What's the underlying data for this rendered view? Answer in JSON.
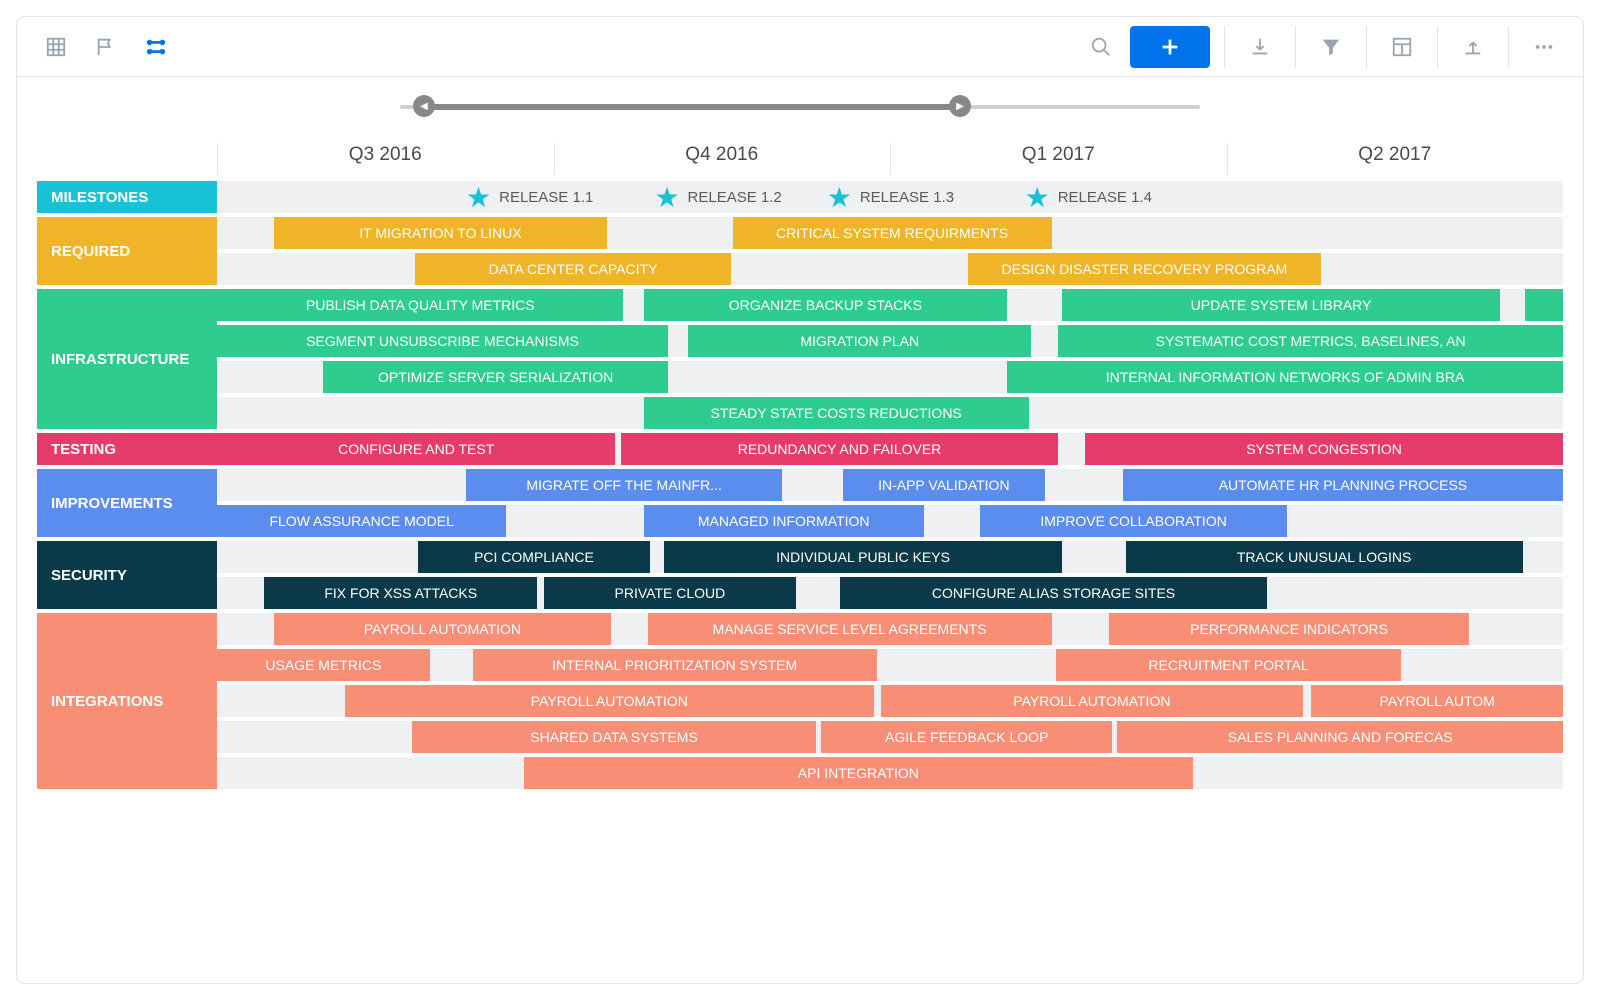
{
  "chart_data": {
    "type": "bar",
    "orientation": "gantt",
    "x_axis": {
      "type": "time",
      "start_quarter": "Q3 2016",
      "end_quarter": "Q2 2017",
      "columns": [
        "Q3 2016",
        "Q4 2016",
        "Q1 2017",
        "Q2 2017"
      ]
    },
    "lanes": [
      {
        "name": "MILESTONES",
        "color": "#17c2d7",
        "type": "milestones",
        "rows": [
          {
            "items": [
              {
                "label": "RELEASE 1.1",
                "position": 18.5
              },
              {
                "label": "RELEASE 1.2",
                "position": 32.5
              },
              {
                "label": "RELEASE 1.3",
                "position": 45.3
              },
              {
                "label": "RELEASE 1.4",
                "position": 60.0
              }
            ]
          }
        ]
      },
      {
        "name": "REQUIRED",
        "color": "#f0b429",
        "rows": [
          {
            "bars": [
              {
                "label": "IT MIGRATION TO LINUX",
                "start": 4.2,
                "end": 29.0
              },
              {
                "label": "CRITICAL SYSTEM REQUIRMENTS",
                "start": 38.3,
                "end": 62.0
              }
            ]
          },
          {
            "bars": [
              {
                "label": "DATA CENTER CAPACITY",
                "start": 14.7,
                "end": 38.2
              },
              {
                "label": "DESIGN DISASTER RECOVERY PROGRAM",
                "start": 55.8,
                "end": 82.0
              }
            ]
          }
        ]
      },
      {
        "name": "INFRASTRUCTURE",
        "color": "#2ecc8f",
        "rows": [
          {
            "bars": [
              {
                "label": "PUBLISH DATA QUALITY METRICS",
                "start": 0.0,
                "end": 30.2
              },
              {
                "label": "ORGANIZE BACKUP STACKS",
                "start": 31.7,
                "end": 58.7
              },
              {
                "label": "UPDATE SYSTEM LIBRARY",
                "start": 62.8,
                "end": 95.3
              },
              {
                "label": "",
                "start": 97.2,
                "end": 100.0
              }
            ]
          },
          {
            "bars": [
              {
                "label": "SEGMENT UNSUBSCRIBE MECHANISMS",
                "start": 0.0,
                "end": 33.5
              },
              {
                "label": "MIGRATION PLAN",
                "start": 35.0,
                "end": 60.5
              },
              {
                "label": "SYSTEMATIC COST METRICS, BASELINES, AN",
                "start": 62.5,
                "end": 100.0
              }
            ]
          },
          {
            "bars": [
              {
                "label": "OPTIMIZE SERVER SERIALIZATION",
                "start": 7.9,
                "end": 33.5
              },
              {
                "label": "INTERNAL INFORMATION NETWORKS OF ADMIN BRA",
                "start": 58.7,
                "end": 100.0
              }
            ]
          },
          {
            "bars": [
              {
                "label": "STEADY STATE COSTS REDUCTIONS",
                "start": 31.7,
                "end": 60.3
              }
            ]
          }
        ]
      },
      {
        "name": "TESTING",
        "color": "#e73c6b",
        "rows": [
          {
            "bars": [
              {
                "label": "CONFIGURE AND TEST",
                "start": 0.0,
                "end": 29.6
              },
              {
                "label": "REDUNDANCY AND FAILOVER",
                "start": 30.0,
                "end": 62.5
              },
              {
                "label": "SYSTEM CONGESTION",
                "start": 64.5,
                "end": 100.0
              }
            ]
          }
        ]
      },
      {
        "name": "IMPROVEMENTS",
        "color": "#5b8def",
        "rows": [
          {
            "bars": [
              {
                "label": "MIGRATE OFF THE MAINFR...",
                "start": 18.5,
                "end": 42.0
              },
              {
                "label": "IN-APP VALIDATION",
                "start": 46.5,
                "end": 61.5
              },
              {
                "label": "AUTOMATE HR PLANNING PROCESS",
                "start": 67.3,
                "end": 100.0
              }
            ]
          },
          {
            "bars": [
              {
                "label": "FLOW ASSURANCE MODEL",
                "start": 0.0,
                "end": 21.5
              },
              {
                "label": "MANAGED INFORMATION",
                "start": 31.7,
                "end": 52.5
              },
              {
                "label": "IMPROVE COLLABORATION",
                "start": 56.7,
                "end": 79.5
              }
            ]
          }
        ]
      },
      {
        "name": "SECURITY",
        "color": "#0a3a4a",
        "rows": [
          {
            "bars": [
              {
                "label": "PCI COMPLIANCE",
                "start": 14.9,
                "end": 32.2
              },
              {
                "label": "INDIVIDUAL PUBLIC KEYS",
                "start": 33.2,
                "end": 62.8
              },
              {
                "label": "TRACK UNUSUAL LOGINS",
                "start": 67.5,
                "end": 97.0
              }
            ]
          },
          {
            "bars": [
              {
                "label": "FIX FOR XSS ATTACKS",
                "start": 3.5,
                "end": 23.8
              },
              {
                "label": "PRIVATE CLOUD",
                "start": 24.3,
                "end": 43.0
              },
              {
                "label": "CONFIGURE ALIAS STORAGE SITES",
                "start": 46.3,
                "end": 78.0
              }
            ]
          }
        ]
      },
      {
        "name": "INTEGRATIONS",
        "color": "#f88e76",
        "rows": [
          {
            "bars": [
              {
                "label": "PAYROLL AUTOMATION",
                "start": 4.2,
                "end": 29.3
              },
              {
                "label": "MANAGE SERVICE LEVEL AGREEMENTS",
                "start": 32.0,
                "end": 62.0
              },
              {
                "label": "PERFORMANCE INDICATORS",
                "start": 66.3,
                "end": 93.0
              }
            ]
          },
          {
            "bars": [
              {
                "label": "USAGE METRICS",
                "start": 0.0,
                "end": 15.8
              },
              {
                "label": "INTERNAL PRIORITIZATION SYSTEM",
                "start": 19.0,
                "end": 49.0
              },
              {
                "label": "RECRUITMENT PORTAL",
                "start": 62.3,
                "end": 88.0
              }
            ]
          },
          {
            "bars": [
              {
                "label": "PAYROLL AUTOMATION",
                "start": 9.5,
                "end": 48.8
              },
              {
                "label": "PAYROLL AUTOMATION",
                "start": 49.3,
                "end": 80.7
              },
              {
                "label": "PAYROLL AUTOM",
                "start": 81.3,
                "end": 100.0
              }
            ]
          },
          {
            "bars": [
              {
                "label": "SHARED DATA SYSTEMS",
                "start": 14.5,
                "end": 44.5
              },
              {
                "label": "AGILE FEEDBACK LOOP",
                "start": 44.9,
                "end": 66.5
              },
              {
                "label": "SALES PLANNING AND FORECAS",
                "start": 66.9,
                "end": 100.0
              }
            ]
          },
          {
            "bars": [
              {
                "label": "API INTEGRATION",
                "start": 22.8,
                "end": 72.5
              }
            ]
          }
        ]
      }
    ]
  },
  "slider": {
    "start_pct": 3,
    "end_pct": 70
  },
  "colors": {
    "milestones": "#17c2d7",
    "required": "#f0b429",
    "infrastructure": "#2ecc8f",
    "testing": "#e73c6b",
    "improvements": "#5b8def",
    "security": "#0a3a4a",
    "integrations": "#f88e76"
  }
}
